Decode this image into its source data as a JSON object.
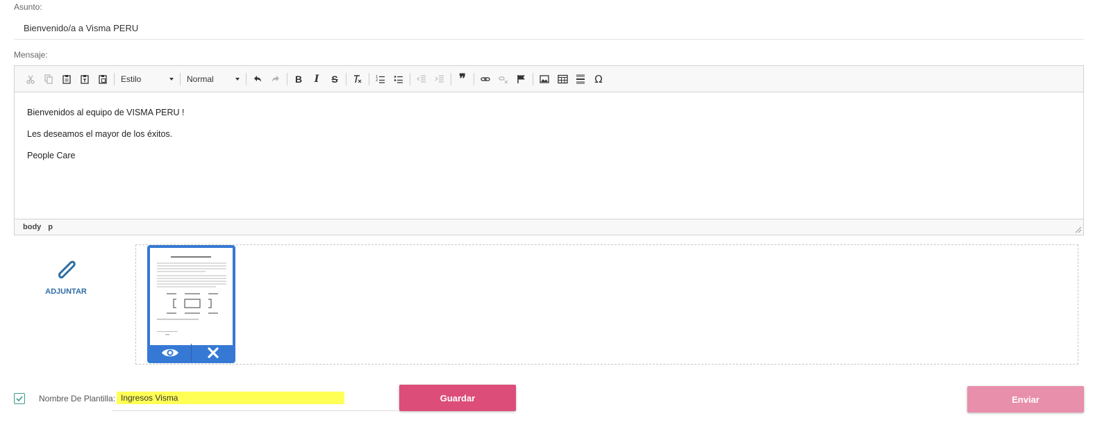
{
  "subject": {
    "label": "Asunto:",
    "value": "Bienvenido/a a Visma PERU"
  },
  "message": {
    "label": "Mensaje:",
    "toolbar": {
      "style_combo": "Estilo",
      "format_combo": "Normal",
      "bold": "B",
      "italic": "I",
      "strike": "S",
      "blockquote": "❞",
      "special_char": "Ω"
    },
    "paragraphs": [
      "Bienvenidos al equipo de VISMA PERU !",
      "Les deseamos el mayor de los éxitos.",
      "People Care"
    ],
    "status_path": [
      "body",
      "p"
    ]
  },
  "attach": {
    "label": "ADJUNTAR",
    "icon": "paperclip-icon"
  },
  "attachment": {
    "actions": [
      "eye-icon",
      "close-icon"
    ]
  },
  "template": {
    "checked": true,
    "label": "Nombre De Plantilla:",
    "value": "Ingresos Visma"
  },
  "buttons": {
    "save": "Guardar",
    "send": "Enviar"
  },
  "colors": {
    "save": "#dc4d7a",
    "send": "#e88fab",
    "attach": "#2e6da4",
    "thumb": "#3579d4",
    "highlight": "#ffff55"
  }
}
